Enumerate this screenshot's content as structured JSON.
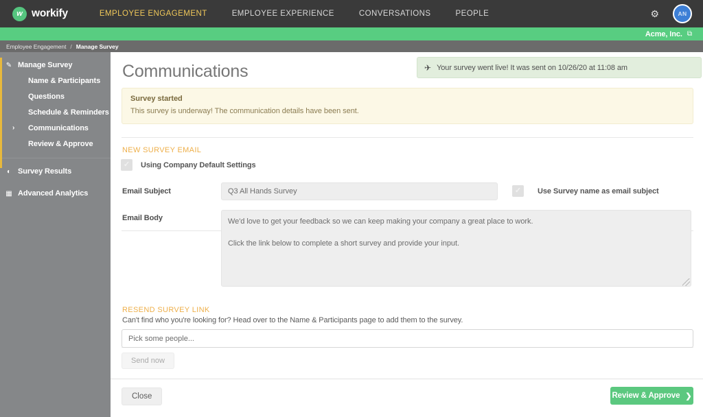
{
  "topnav": {
    "logo_mark": "w",
    "logo_text": "workify",
    "items": [
      {
        "label": "EMPLOYEE ENGAGEMENT",
        "active": true
      },
      {
        "label": "EMPLOYEE EXPERIENCE",
        "active": false
      },
      {
        "label": "CONVERSATIONS",
        "active": false
      },
      {
        "label": "PEOPLE",
        "active": false
      }
    ],
    "gear_icon": "gear-icon",
    "avatar_initials": "AN"
  },
  "greenbar": {
    "company": "Acme, Inc.",
    "external_link_icon": "external-link-icon"
  },
  "breadcrumb": {
    "root": "Employee Engagement",
    "separator": "/",
    "current": "Manage Survey"
  },
  "sidebar": {
    "manage_survey": {
      "label": "Manage Survey",
      "icon": "edit-square-icon",
      "children": [
        {
          "label": "Name & Participants"
        },
        {
          "label": "Questions"
        },
        {
          "label": "Schedule & Reminders"
        },
        {
          "label": "Communications",
          "active": true,
          "caret": "›"
        },
        {
          "label": "Review & Approve"
        }
      ]
    },
    "sections": [
      {
        "label": "Survey Results",
        "icon": "pie-chart-icon"
      },
      {
        "label": "Advanced Analytics",
        "icon": "bar-chart-icon"
      }
    ],
    "accent_color": "#e8b93c"
  },
  "main": {
    "toast": {
      "icon": "paper-plane-icon",
      "text": "Your survey went live! It was sent on 10/26/20 at 11:08 am"
    },
    "page_title": "Communications",
    "alert": {
      "title": "Survey started",
      "body": "This survey is underway! The communication details have been sent."
    },
    "new_survey_email": {
      "section_title": "NEW SURVEY EMAIL",
      "default_settings_label": "Using Company Default Settings",
      "subject_label": "Email Subject",
      "subject_value": "Q3 All Hands Survey",
      "use_survey_name_label": "Use Survey name as email subject",
      "body_label": "Email Body",
      "body_line1": "We'd love to get your feedback so we can keep making your company a great place to work.",
      "body_line2": "Click the link below to complete a short survey and provide your input."
    },
    "resend_survey_link": {
      "section_title": "RESEND SURVEY LINK",
      "help_text": "Can't find who you're looking for? Head over to the Name & Participants page to add them to the survey.",
      "people_placeholder": "Pick some people...",
      "send_now_label": "Send now"
    },
    "footer": {
      "close_label": "Close",
      "review_label": "Review & Approve",
      "review_chevron": "❯",
      "review_color": "#5bc87f"
    }
  }
}
